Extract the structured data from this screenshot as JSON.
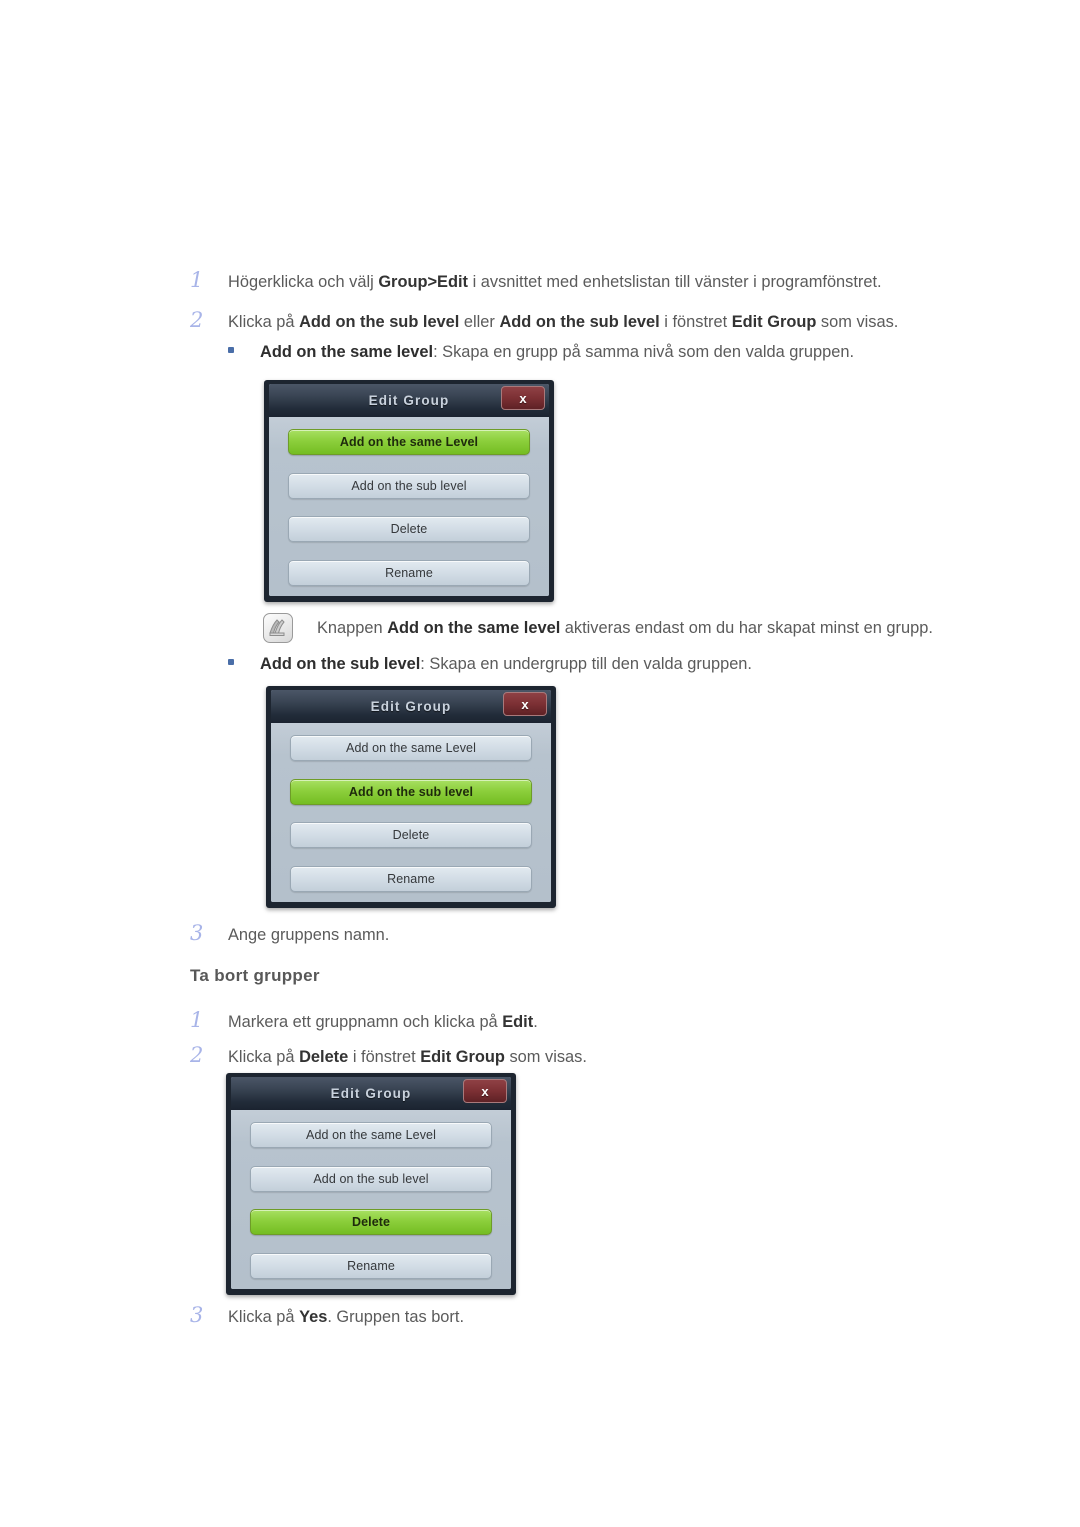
{
  "document": {
    "language": "sv",
    "colors": {
      "step_number": "#a8b4e8",
      "body_text": "#5b5b5b",
      "bullet": "#4a6ea8",
      "dialog_selected_green": "#8ccf3c",
      "dialog_titlebar": "#2b3644",
      "dialog_close_red": "#7c3034"
    }
  },
  "steps_add": [
    {
      "num": "1",
      "parts": [
        {
          "t": "Högerklicka och välj ",
          "b": false
        },
        {
          "t": "Group>Edit",
          "b": true
        },
        {
          "t": " i avsnittet med enhetslistan till vänster i programfönstret.",
          "b": false
        }
      ]
    },
    {
      "num": "2",
      "parts": [
        {
          "t": "Klicka på ",
          "b": false
        },
        {
          "t": "Add on the sub level",
          "b": true
        },
        {
          "t": " eller ",
          "b": false
        },
        {
          "t": "Add on the sub level",
          "b": true
        },
        {
          "t": " i fönstret ",
          "b": false
        },
        {
          "t": "Edit Group",
          "b": true
        },
        {
          "t": " som visas.",
          "b": false
        }
      ]
    }
  ],
  "bullet_same_level": {
    "parts": [
      {
        "t": "Add on the same level",
        "b": true
      },
      {
        "t": ": Skapa en grupp på samma nivå som den valda gruppen.",
        "b": false
      }
    ]
  },
  "bullet_sub_level": {
    "parts": [
      {
        "t": "Add on the sub level",
        "b": true
      },
      {
        "t": ": Skapa en undergrupp till den valda gruppen.",
        "b": false
      }
    ]
  },
  "note": {
    "icon": "note-pen-icon",
    "parts": [
      {
        "t": "Knappen ",
        "b": false
      },
      {
        "t": "Add on the same level",
        "b": true
      },
      {
        "t": " aktiveras endast om du har skapat minst en grupp.",
        "b": false
      }
    ]
  },
  "step_name_group": {
    "num": "3",
    "parts": [
      {
        "t": "Ange gruppens namn.",
        "b": false
      }
    ]
  },
  "heading_delete_groups": "Ta bort grupper",
  "steps_delete": [
    {
      "num": "1",
      "parts": [
        {
          "t": "Markera ett gruppnamn och klicka på ",
          "b": false
        },
        {
          "t": "Edit",
          "b": true
        },
        {
          "t": ".",
          "b": false
        }
      ]
    },
    {
      "num": "2",
      "parts": [
        {
          "t": "Klicka på ",
          "b": false
        },
        {
          "t": "Delete",
          "b": true
        },
        {
          "t": " i fönstret ",
          "b": false
        },
        {
          "t": "Edit Group",
          "b": true
        },
        {
          "t": " som visas.",
          "b": false
        }
      ]
    },
    {
      "num": "3",
      "parts": [
        {
          "t": "Klicka på ",
          "b": false
        },
        {
          "t": "Yes",
          "b": true
        },
        {
          "t": ". Gruppen tas bort.",
          "b": false
        }
      ]
    }
  ],
  "dialogs": [
    {
      "id": "dialog-same-level",
      "title": "Edit Group",
      "close_label": "x",
      "buttons": [
        {
          "label": "Add on the same Level",
          "selected": true
        },
        {
          "label": "Add on the sub level",
          "selected": false
        },
        {
          "label": "Delete",
          "selected": false
        },
        {
          "label": "Rename",
          "selected": false
        }
      ]
    },
    {
      "id": "dialog-sub-level",
      "title": "Edit Group",
      "close_label": "x",
      "buttons": [
        {
          "label": "Add on the same Level",
          "selected": false
        },
        {
          "label": "Add on the sub level",
          "selected": true
        },
        {
          "label": "Delete",
          "selected": false
        },
        {
          "label": "Rename",
          "selected": false
        }
      ]
    },
    {
      "id": "dialog-delete",
      "title": "Edit Group",
      "close_label": "x",
      "buttons": [
        {
          "label": "Add on the same Level",
          "selected": false
        },
        {
          "label": "Add on the sub level",
          "selected": false
        },
        {
          "label": "Delete",
          "selected": true
        },
        {
          "label": "Rename",
          "selected": false
        }
      ]
    }
  ]
}
